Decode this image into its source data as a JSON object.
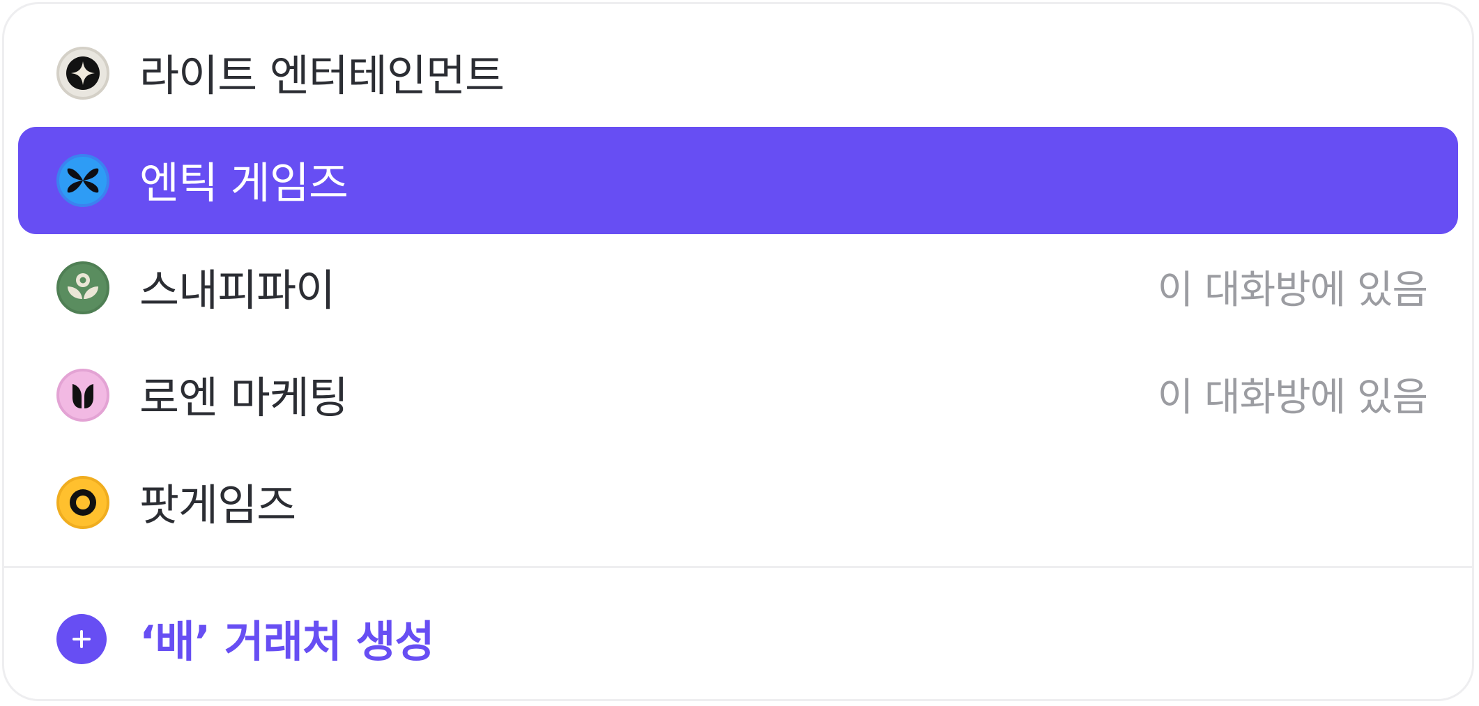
{
  "items": [
    {
      "name": "라이트 엔터테인먼트",
      "status": "",
      "selected": false,
      "icon": "sparkle-icon",
      "icon_bg": "#e9e6df",
      "icon_border": "#d4d0c7"
    },
    {
      "name": "엔틱 게임즈",
      "status": "",
      "selected": true,
      "icon": "butterfly-icon",
      "icon_bg": "#2e9cf5",
      "icon_border": "#3b82f0"
    },
    {
      "name": "스내피파이",
      "status": "이 대화방에 있음",
      "selected": false,
      "icon": "flower-icon",
      "icon_bg": "#5a8d5f",
      "icon_border": "#4f7f54"
    },
    {
      "name": "로엔 마케팅",
      "status": "이 대화방에 있음",
      "selected": false,
      "icon": "tulip-icon",
      "icon_bg": "#f2b9e3",
      "icon_border": "#e3a3d4"
    },
    {
      "name": "팟게임즈",
      "status": "",
      "selected": false,
      "icon": "ring-icon",
      "icon_bg": "#ffc02e",
      "icon_border": "#f0ad1f"
    }
  ],
  "create": {
    "label": "‘배’ 거래처 생성",
    "icon": "plus-icon"
  },
  "colors": {
    "accent": "#674ef3",
    "text": "#2b2d33",
    "muted": "#9b9ca1",
    "border": "#eeeef0"
  }
}
